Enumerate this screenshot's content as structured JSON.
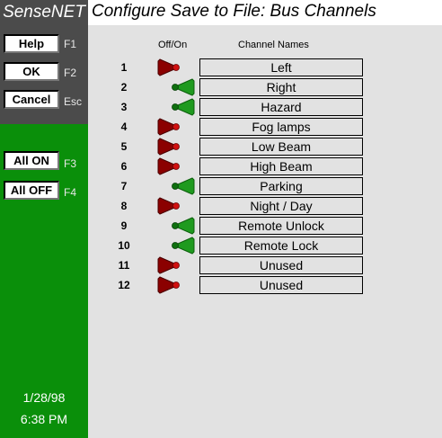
{
  "app": {
    "brand": "SenseNET",
    "title": "Configure Save to File: Bus Channels"
  },
  "colors": {
    "panel_dark": "#4b4b4b",
    "panel_green": "#0a8f0a",
    "toggle_off": "#8b0000",
    "toggle_on": "#1f9a1f"
  },
  "sidebar": {
    "buttons": [
      {
        "label": "Help",
        "key": "F1"
      },
      {
        "label": "OK",
        "key": "F2"
      },
      {
        "label": "Cancel",
        "key": "Esc"
      },
      {
        "label": "All ON",
        "key": "F3"
      },
      {
        "label": "All OFF",
        "key": "F4"
      }
    ],
    "date": "1/28/98",
    "time": "6:38 PM"
  },
  "table": {
    "col_toggle": "Off/On",
    "col_names": "Channel Names",
    "rows": [
      {
        "num": "1",
        "state": "off",
        "name": "Left"
      },
      {
        "num": "2",
        "state": "on",
        "name": "Right"
      },
      {
        "num": "3",
        "state": "on",
        "name": "Hazard"
      },
      {
        "num": "4",
        "state": "off",
        "name": "Fog lamps"
      },
      {
        "num": "5",
        "state": "off",
        "name": "Low Beam"
      },
      {
        "num": "6",
        "state": "off",
        "name": "High Beam"
      },
      {
        "num": "7",
        "state": "on",
        "name": "Parking"
      },
      {
        "num": "8",
        "state": "off",
        "name": "Night / Day"
      },
      {
        "num": "9",
        "state": "on",
        "name": "Remote Unlock"
      },
      {
        "num": "10",
        "state": "on",
        "name": "Remote Lock"
      },
      {
        "num": "11",
        "state": "off",
        "name": "Unused"
      },
      {
        "num": "12",
        "state": "off",
        "name": "Unused"
      }
    ]
  }
}
